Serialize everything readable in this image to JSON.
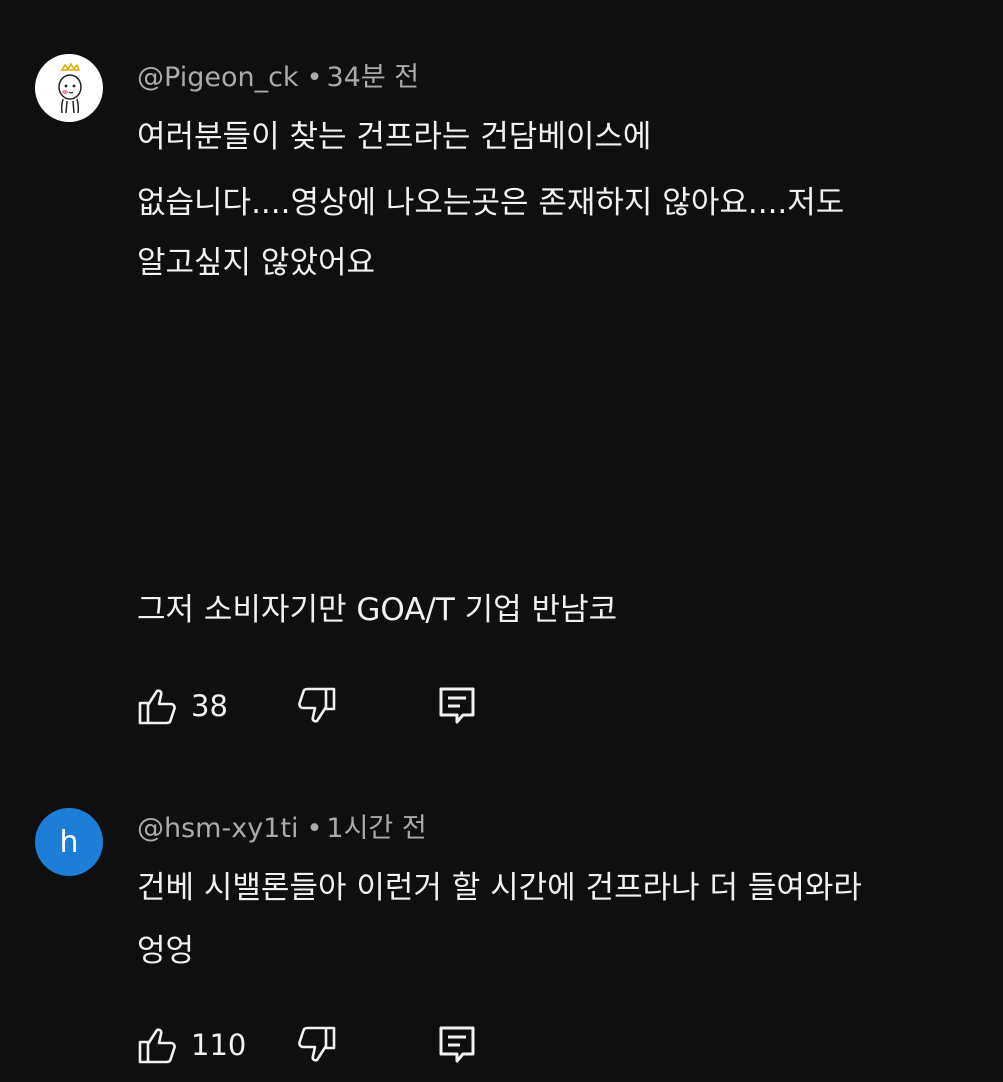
{
  "comments": [
    {
      "handle": "@Pigeon_ck",
      "separator": "•",
      "time": "34분 전",
      "lines": [
        "여러분들이 찾는 건프라는 건담베이스에",
        "없습니다....영상에 나오는곳은 존재하지 않아요....저도",
        "알고싶지 않았어요",
        "그저 소비자기만 GOA/T 기업 반남코"
      ],
      "likes": "38",
      "icons": {
        "avatar": "cartoon-avatar",
        "like": "thumb-up-icon",
        "dislike": "thumb-down-icon",
        "reply": "reply-icon"
      }
    },
    {
      "handle": "@hsm-xy1ti",
      "separator": "•",
      "time": "1시간 전",
      "avatar_letter": "h",
      "avatar_color": "#1c7ed6",
      "lines": [
        "건베 시밸론들아 이런거 할 시간에 건프라나 더 들여와라",
        "엉엉"
      ],
      "likes": "110",
      "icons": {
        "avatar": "letter-avatar",
        "like": "thumb-up-icon",
        "dislike": "thumb-down-icon",
        "reply": "reply-icon"
      }
    }
  ]
}
